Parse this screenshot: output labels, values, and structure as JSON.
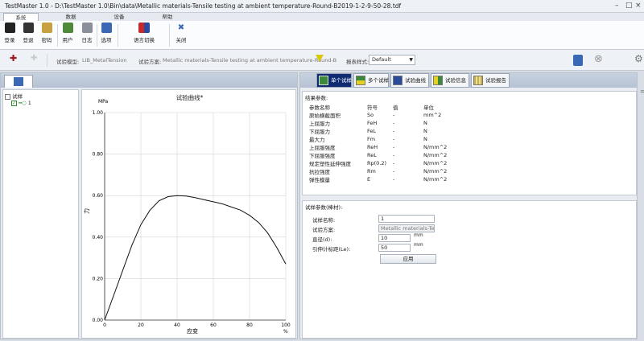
{
  "window": {
    "title": "TestMaster 1.0 - D:\\TestMaster 1.0\\Bin\\data\\Metallic materials-Tensile testing at ambient temperature-Round-B2019-1-2-9-50-28.tdf"
  },
  "menu_tabs": [
    "系统",
    "数据",
    "设备",
    "帮助"
  ],
  "ribbon": {
    "login": "登录",
    "logout": "登退",
    "password": "密码",
    "user": "用户",
    "log": "日志",
    "options": "选项",
    "language": "语言切换",
    "close": "关闭"
  },
  "toolbar": {
    "model_label": "试验模型:",
    "model_value": "LIB_MetalTension",
    "plan_label": "试验方案:",
    "plan_value": "Metallic materials-Tensile testing at ambient temperature-Round-B",
    "report_label": "报表样式:",
    "report_value": "Default"
  },
  "tree": {
    "root": "试样",
    "child": "1"
  },
  "chart_data": {
    "type": "line",
    "title": "试验曲线*",
    "xlabel": "应变",
    "x_unit": "%",
    "ylabel": "力",
    "y_unit": "MPa",
    "xlim": [
      0,
      100
    ],
    "ylim": [
      0,
      1.0
    ],
    "x_ticks": [
      "0",
      "20",
      "40",
      "60",
      "80",
      "100"
    ],
    "y_ticks": [
      "0.00",
      "0.20",
      "0.40",
      "0.60",
      "0.80",
      "1.00"
    ],
    "grid": true,
    "series": [
      {
        "x": [
          0,
          5,
          10,
          15,
          20,
          25,
          30,
          35,
          40,
          45,
          50,
          55,
          60,
          65,
          70,
          75,
          80,
          85,
          90,
          95,
          100
        ],
        "y": [
          0.0,
          0.12,
          0.24,
          0.36,
          0.46,
          0.53,
          0.575,
          0.595,
          0.6,
          0.598,
          0.59,
          0.58,
          0.57,
          0.56,
          0.545,
          0.53,
          0.505,
          0.47,
          0.42,
          0.35,
          0.27
        ]
      }
    ]
  },
  "right_tabs": [
    "单个试样",
    "多个试样",
    "试验曲线",
    "试验信息",
    "试验报告"
  ],
  "results": {
    "title": "结果参数:",
    "headers": [
      "参数名称",
      "符号",
      "值",
      "单位"
    ],
    "rows": [
      [
        "原始横截面积",
        "So",
        "-",
        "mm^2"
      ],
      [
        "上屈服力",
        "FeH",
        "-",
        "N"
      ],
      [
        "下屈服力",
        "FeL",
        "-",
        "N"
      ],
      [
        "最大力",
        "Fm",
        "-",
        "N"
      ],
      [
        "上屈服强度",
        "ReH",
        "-",
        "N/mm^2"
      ],
      [
        "下屈服强度",
        "ReL",
        "-",
        "N/mm^2"
      ],
      [
        "规定塑性延伸强度",
        "Rp(0.2)",
        "-",
        "N/mm^2"
      ],
      [
        "抗拉强度",
        "Rm",
        "-",
        "N/mm^2"
      ],
      [
        "弹性模量",
        "E",
        "-",
        "N/mm^2"
      ]
    ]
  },
  "sample": {
    "title": "试样参数(棒材):",
    "name_label": "试样名称:",
    "name_value": "1",
    "plan_label": "试验方案:",
    "plan_value": "Metallic materials-Tensil",
    "dia_label": "直径(d):",
    "dia_value": "10",
    "dia_unit": "mm",
    "gauge_label": "引伸计标距(Le):",
    "gauge_value": "50",
    "gauge_unit": "mm",
    "apply": "应用"
  },
  "colors": {
    "active_tab": "#102a72",
    "accent": "#2b4a8a"
  }
}
